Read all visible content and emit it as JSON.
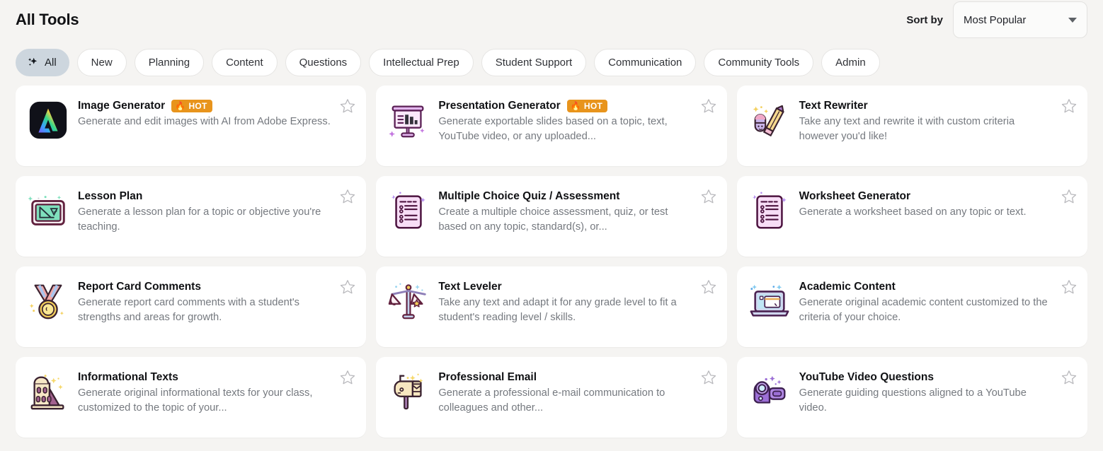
{
  "header": {
    "title": "All Tools",
    "sort_label": "Sort by",
    "sort_value": "Most Popular",
    "sort_options": [
      "Most Popular"
    ],
    "chevron_icon": "chevron-down-icon"
  },
  "filters": [
    {
      "label": "All",
      "active": true,
      "icon": "sparkles-icon"
    },
    {
      "label": "New",
      "active": false
    },
    {
      "label": "Planning",
      "active": false
    },
    {
      "label": "Content",
      "active": false
    },
    {
      "label": "Questions",
      "active": false
    },
    {
      "label": "Intellectual Prep",
      "active": false
    },
    {
      "label": "Student Support",
      "active": false
    },
    {
      "label": "Communication",
      "active": false
    },
    {
      "label": "Community Tools",
      "active": false
    },
    {
      "label": "Admin",
      "active": false
    }
  ],
  "badge": {
    "hot_label": "HOT",
    "hot_flame": "🔥",
    "hot_color": "#e8941c"
  },
  "star_icon": "star-outline-icon",
  "colors": {
    "page_background": "#f5f4f2",
    "card_background": "#ffffff",
    "active_pill": "#cdd6de",
    "title_text": "#101114",
    "desc_text": "#75797f"
  },
  "cards": [
    {
      "title": "Image Generator",
      "desc": "Generate and edit images with AI from Adobe Express.",
      "hot": true,
      "icon": "adobe-express-icon",
      "starred": false
    },
    {
      "title": "Presentation Generator",
      "desc": "Generate exportable slides based on a topic, text, YouTube video, or any uploaded...",
      "hot": true,
      "icon": "presentation-board-icon",
      "starred": false
    },
    {
      "title": "Text Rewriter",
      "desc": "Take any text and rewrite it with custom criteria however you'd like!",
      "hot": false,
      "icon": "pencil-eraser-icon",
      "starred": false
    },
    {
      "title": "Lesson Plan",
      "desc": "Generate a lesson plan for a topic or objective you're teaching.",
      "hot": false,
      "icon": "chalkboard-icon",
      "starred": false
    },
    {
      "title": "Multiple Choice Quiz / Assessment",
      "desc": "Create a multiple choice assessment, quiz, or test based on any topic, standard(s), or...",
      "hot": false,
      "icon": "quiz-document-icon",
      "starred": false
    },
    {
      "title": "Worksheet Generator",
      "desc": "Generate a worksheet based on any topic or text.",
      "hot": false,
      "icon": "worksheet-document-icon",
      "starred": false
    },
    {
      "title": "Report Card Comments",
      "desc": "Generate report card comments with a student's strengths and areas for growth.",
      "hot": false,
      "icon": "medal-icon",
      "starred": false
    },
    {
      "title": "Text Leveler",
      "desc": "Take any text and adapt it for any grade level to fit a student's reading level / skills.",
      "hot": false,
      "icon": "balance-scale-icon",
      "starred": false
    },
    {
      "title": "Academic Content",
      "desc": "Generate original academic content customized to the criteria of your choice.",
      "hot": false,
      "icon": "laptop-icon",
      "starred": false
    },
    {
      "title": "Informational Texts",
      "desc": "Generate original informational texts for your class, customized to the topic of your...",
      "hot": false,
      "icon": "colosseum-icon",
      "starred": false
    },
    {
      "title": "Professional Email",
      "desc": "Generate a professional e-mail communication to colleagues and other...",
      "hot": false,
      "icon": "mailbox-icon",
      "starred": false
    },
    {
      "title": "YouTube Video Questions",
      "desc": "Generate guiding questions aligned to a YouTube video.",
      "hot": false,
      "icon": "camcorder-icon",
      "starred": false
    }
  ]
}
